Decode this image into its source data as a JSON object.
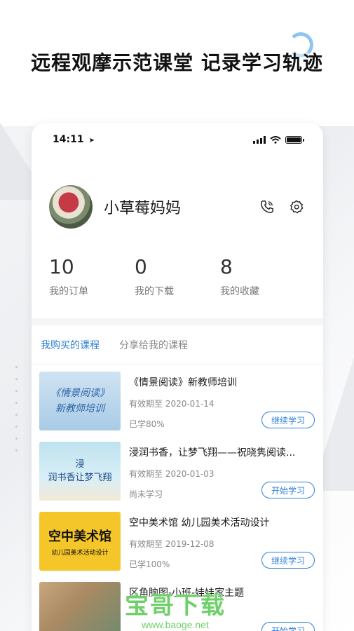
{
  "headline": "远程观摩示范课堂 记录学习轨迹",
  "status": {
    "time": "14:11"
  },
  "profile": {
    "name": "小草莓妈妈"
  },
  "stats": [
    {
      "value": "10",
      "label": "我的订单"
    },
    {
      "value": "0",
      "label": "我的下载"
    },
    {
      "value": "8",
      "label": "我的收藏"
    }
  ],
  "tabs": [
    {
      "label": "我购买的课程"
    },
    {
      "label": "分享给我的课程"
    }
  ],
  "courses": [
    {
      "title": "《情景阅读》新教师培训",
      "expire": "有效期至 2020-01-14",
      "progress": "已学80%",
      "button": "继续学习",
      "thumb_line1": "《情景阅读》",
      "thumb_line2": "新教师培训"
    },
    {
      "title": "浸润书香，让梦飞翔——祝晓隽阅读...",
      "expire": "有效期至 2020-01-03",
      "progress": "尚未学习",
      "button": "开始学习",
      "thumb_line1": "浸",
      "thumb_line2": "润书香让梦飞翔"
    },
    {
      "title": "空中美术馆 幼儿园美术活动设计",
      "expire": "有效期至 2019-12-08",
      "progress": "已学100%",
      "button": "继续学习",
      "thumb_line1": "空中美术馆",
      "thumb_line2": "幼儿园美术活动设计"
    },
    {
      "title": "区角脑图-小班-娃娃家主题",
      "expire": "",
      "progress": "",
      "button": "开始学习"
    }
  ],
  "watermark": {
    "title": "宝哥下载",
    "url": "www.baoge.net"
  },
  "colors": {
    "accent": "#2f7fd9",
    "watermark": "#6fd06a"
  }
}
